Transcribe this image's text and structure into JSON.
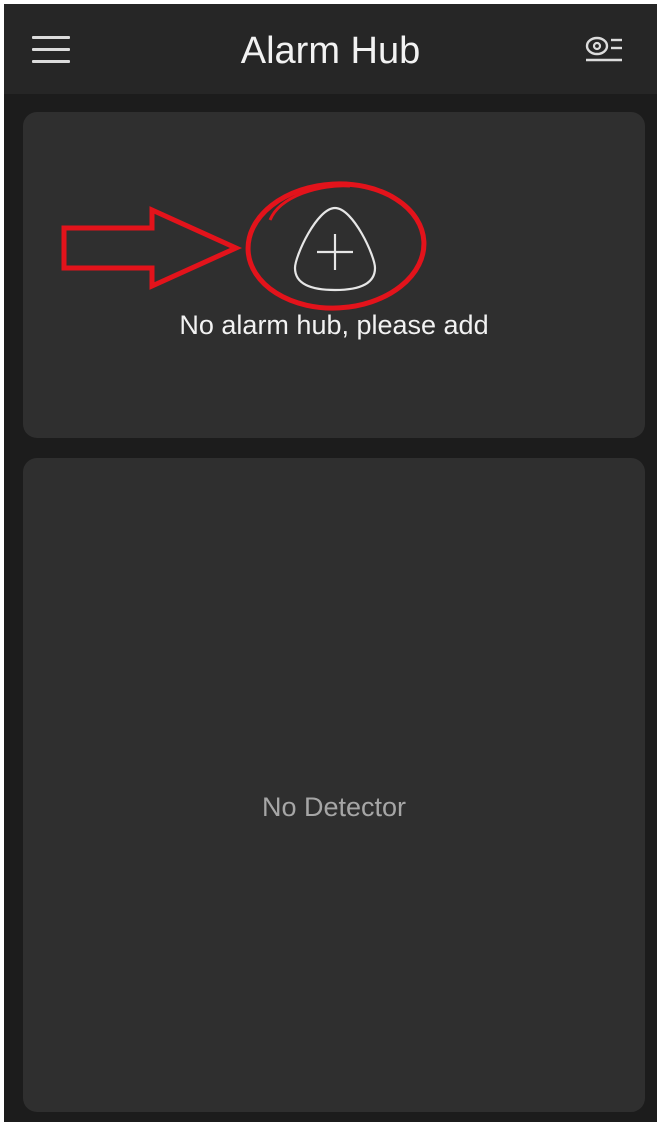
{
  "header": {
    "title": "Alarm Hub",
    "menu_icon": "hamburger-menu-icon",
    "device_icon": "camera-list-icon"
  },
  "hub_card": {
    "add_icon": "add-circle-icon",
    "empty_message": "No alarm hub, please add"
  },
  "detector_card": {
    "empty_message": "No Detector"
  },
  "annotation": {
    "color": "#e3131b",
    "arrow_icon": "arrow-right-icon",
    "highlight_icon": "highlight-ellipse-icon"
  },
  "colors": {
    "background": "#1c1c1c",
    "header": "#262626",
    "card": "#2f2f2f",
    "text_primary": "#f2f2f2",
    "text_secondary": "#a6a6a6"
  }
}
